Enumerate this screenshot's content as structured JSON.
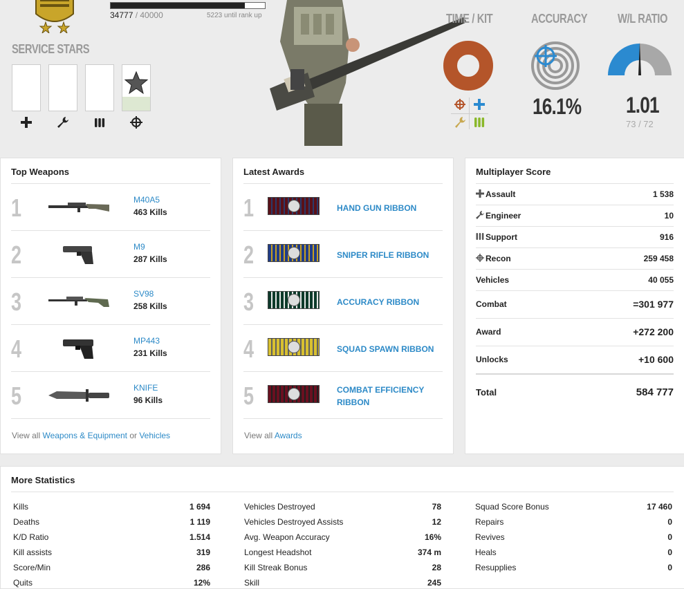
{
  "profile": {
    "xp_current": "34777",
    "xp_max": " / 40000",
    "xp_until": "5223 until rank up",
    "xp_progress": 0.869
  },
  "service_stars": {
    "title": "SERVICE STARS"
  },
  "stats_header": {
    "time_kit_title": "TIME / KIT",
    "accuracy_title": "ACCURACY",
    "accuracy_value": "16.1%",
    "wl_title": "W/L RATIO",
    "wl_value": "1.01",
    "wl_sub": "73 / 72"
  },
  "top_weapons": {
    "title": "Top Weapons",
    "items": [
      {
        "rank": "1",
        "name": "M40A5",
        "kills": "463 Kills"
      },
      {
        "rank": "2",
        "name": "M9",
        "kills": "287 Kills"
      },
      {
        "rank": "3",
        "name": "SV98",
        "kills": "258 Kills"
      },
      {
        "rank": "4",
        "name": "MP443",
        "kills": "231 Kills"
      },
      {
        "rank": "5",
        "name": "KNIFE",
        "kills": "96 Kills"
      }
    ],
    "view_all_prefix": "View all ",
    "view_all_link1": "Weapons & Equipment",
    "view_all_or": " or ",
    "view_all_link2": "Vehicles"
  },
  "latest_awards": {
    "title": "Latest Awards",
    "items": [
      {
        "rank": "1",
        "name": "HAND GUN RIBBON",
        "color1": "#5a1018",
        "color2": "#2a3a6a"
      },
      {
        "rank": "2",
        "name": "SNIPER RIFLE RIBBON",
        "color1": "#1f3c8a",
        "color2": "#c8a020"
      },
      {
        "rank": "3",
        "name": "ACCURACY RIBBON",
        "color1": "#0d3a2a",
        "color2": "#e8e8e8"
      },
      {
        "rank": "4",
        "name": "SQUAD SPAWN RIBBON",
        "color1": "#d8c030",
        "color2": "#606060"
      },
      {
        "rank": "5",
        "name": "COMBAT EFFICIENCY RIBBON",
        "color1": "#6a1020",
        "color2": "#202020"
      }
    ],
    "view_all_prefix": "View all ",
    "view_all_link": "Awards"
  },
  "multiplayer_score": {
    "title": "Multiplayer Score",
    "rows": [
      {
        "label": "Assault",
        "value": "1 538",
        "icon": "assault-icon"
      },
      {
        "label": "Engineer",
        "value": "10",
        "icon": "wrench-icon"
      },
      {
        "label": "Support",
        "value": "916",
        "icon": "ammo-icon"
      },
      {
        "label": "Recon",
        "value": "259 458",
        "icon": "crosshair-icon"
      },
      {
        "label": "Vehicles",
        "value": "40 055",
        "icon": ""
      },
      {
        "label": "Combat",
        "value": "=301 977",
        "icon": ""
      },
      {
        "label": "Award",
        "value": "+272 200",
        "icon": ""
      },
      {
        "label": "Unlocks",
        "value": "+10 600",
        "icon": ""
      },
      {
        "label": "Total",
        "value": "584 777",
        "icon": ""
      }
    ]
  },
  "more_statistics": {
    "title": "More Statistics",
    "col1": [
      {
        "label": "Kills",
        "value": "1 694"
      },
      {
        "label": "Deaths",
        "value": "1 119"
      },
      {
        "label": "K/D Ratio",
        "value": "1.514"
      },
      {
        "label": "Kill assists",
        "value": "319"
      },
      {
        "label": "Score/Min",
        "value": "286"
      },
      {
        "label": "Quits",
        "value": "12%"
      }
    ],
    "col2": [
      {
        "label": "Vehicles Destroyed",
        "value": "78"
      },
      {
        "label": "Vehicles Destroyed Assists",
        "value": "12"
      },
      {
        "label": "Avg. Weapon Accuracy",
        "value": "16%"
      },
      {
        "label": "Longest Headshot",
        "value": "374 m"
      },
      {
        "label": "Kill Streak Bonus",
        "value": "28"
      },
      {
        "label": "Skill",
        "value": "245"
      }
    ],
    "col3": [
      {
        "label": "Squad Score Bonus",
        "value": "17 460"
      },
      {
        "label": "Repairs",
        "value": "0"
      },
      {
        "label": "Revives",
        "value": "0"
      },
      {
        "label": "Heals",
        "value": "0"
      },
      {
        "label": "Resupplies",
        "value": "0"
      }
    ]
  },
  "colors": {
    "link": "#2d8ac7",
    "kit_orange": "#b4552a",
    "accuracy_blue": "#2b8ad0",
    "wl_blue": "#2b8ad0",
    "support_green": "#8ab82a"
  }
}
